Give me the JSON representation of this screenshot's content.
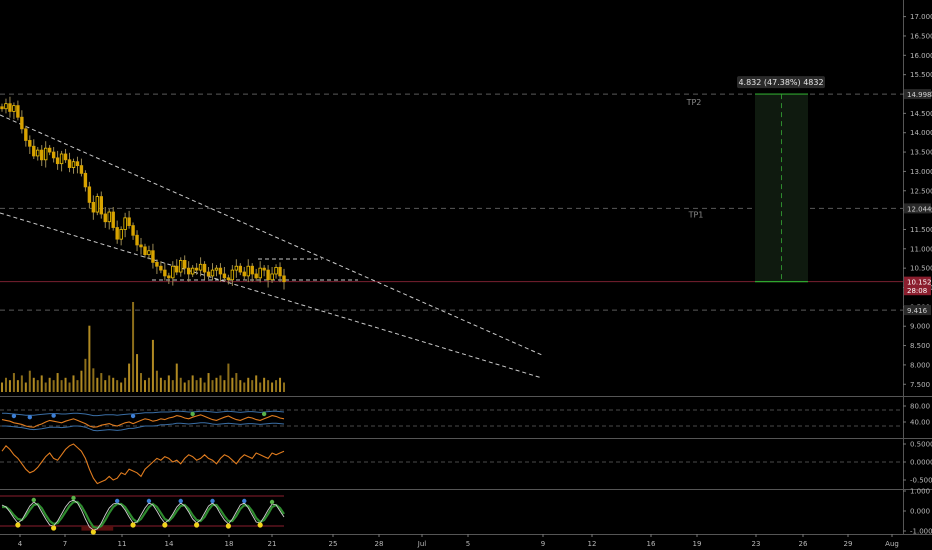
{
  "chart_data": {
    "type": "candlestick",
    "x_tick_labels": [
      "4",
      "7",
      "11",
      "14",
      "18",
      "21",
      "25",
      "28",
      "Jul",
      "5",
      "9",
      "12",
      "16",
      "19",
      "23",
      "26",
      "29",
      "Aug"
    ],
    "price_axis": {
      "ticks": [
        "17.000",
        "16.500",
        "16.000",
        "15.500",
        "15.000",
        "14.500",
        "14.000",
        "13.500",
        "13.000",
        "12.500",
        "12.000",
        "11.500",
        "11.000",
        "10.500",
        "10.000",
        "9.500",
        "9.000",
        "8.500",
        "8.000",
        "7.500"
      ],
      "range": [
        7.3,
        17.3
      ]
    },
    "price_markers": [
      {
        "label": "14.998",
        "value": 14.998,
        "style": "dark"
      },
      {
        "label": "12.044",
        "value": 12.044,
        "style": "dark"
      },
      {
        "label": "10.152",
        "value": 10.152,
        "style": "current"
      },
      {
        "label": "28:08",
        "value": 9.93,
        "style": "current"
      },
      {
        "label": "9.416",
        "value": 9.416,
        "style": "dark"
      }
    ],
    "take_profit_levels": [
      {
        "label": "TP2",
        "value": 14.998
      },
      {
        "label": "TP1",
        "value": 12.044
      }
    ],
    "projection_box": {
      "label": "4.832 (47.38%) 4832",
      "from": 10.152,
      "to": 14.998
    },
    "price_series": [
      14.62,
      14.75,
      14.55,
      14.7,
      14.4,
      14.1,
      13.8,
      13.65,
      13.4,
      13.55,
      13.3,
      13.6,
      13.5,
      13.35,
      13.2,
      13.45,
      13.3,
      13.1,
      13.25,
      13.15,
      12.95,
      12.6,
      12.2,
      11.95,
      12.35,
      11.9,
      11.7,
      11.95,
      11.55,
      11.25,
      11.5,
      11.8,
      11.6,
      11.35,
      11.1,
      11.05,
      10.85,
      10.95,
      10.65,
      10.55,
      10.45,
      10.3,
      10.25,
      10.55,
      10.4,
      10.7,
      10.5,
      10.35,
      10.5,
      10.45,
      10.6,
      10.4,
      10.3,
      10.45,
      10.5,
      10.35,
      10.25,
      10.2,
      10.45,
      10.55,
      10.4,
      10.3,
      10.55,
      10.35,
      10.25,
      10.5,
      10.45,
      10.2,
      10.35,
      10.52,
      10.3,
      10.15
    ],
    "volume_series": [
      4,
      6,
      5,
      8,
      5,
      7,
      4,
      9,
      6,
      5,
      7,
      4,
      6,
      5,
      8,
      5,
      6,
      4,
      7,
      5,
      9,
      14,
      28,
      10,
      6,
      8,
      5,
      7,
      6,
      5,
      4,
      6,
      12,
      38,
      16,
      8,
      5,
      6,
      22,
      9,
      6,
      5,
      7,
      5,
      12,
      6,
      4,
      5,
      7,
      5,
      6,
      4,
      8,
      5,
      6,
      7,
      5,
      12,
      6,
      8,
      5,
      4,
      6,
      5,
      7,
      4,
      6,
      5,
      4,
      5,
      6,
      4
    ],
    "indicator_1": {
      "ticks": [
        "80.00",
        "40.00"
      ],
      "levels": [
        70,
        30
      ],
      "series": [
        46,
        44,
        42,
        38,
        36,
        34,
        30,
        28,
        27,
        32,
        35,
        40,
        44,
        42,
        40,
        38,
        42,
        45,
        48,
        44,
        40,
        36,
        30,
        27,
        28,
        32,
        34,
        36,
        32,
        30,
        34,
        38,
        40,
        36,
        40,
        44,
        48,
        46,
        42,
        44,
        48,
        46,
        50,
        52,
        56,
        54,
        50,
        48,
        52,
        55,
        58,
        54,
        50,
        46,
        44,
        48,
        52,
        55,
        50,
        46,
        44,
        48,
        52,
        50,
        46,
        44,
        48,
        52,
        56,
        54,
        50,
        48
      ],
      "band_upper": [
        62,
        62,
        61,
        60,
        59,
        58,
        57,
        57,
        57,
        58,
        59,
        60,
        61,
        61,
        61,
        60,
        60,
        61,
        62,
        62,
        61,
        60,
        58,
        56,
        56,
        57,
        58,
        58,
        58,
        57,
        58,
        59,
        60,
        60,
        61,
        62,
        63,
        63,
        63,
        64,
        65,
        65,
        65,
        66,
        67,
        67,
        66,
        65,
        65,
        66,
        67,
        67,
        66,
        65,
        64,
        65,
        66,
        67,
        66,
        65,
        64,
        65,
        66,
        66,
        65,
        64,
        65,
        66,
        67,
        67,
        66,
        65
      ],
      "band_lower": [
        30,
        30,
        29,
        28,
        27,
        26,
        24,
        22,
        21,
        22,
        23,
        25,
        27,
        27,
        27,
        26,
        27,
        28,
        30,
        30,
        29,
        27,
        23,
        19,
        18,
        19,
        20,
        21,
        20,
        19,
        20,
        22,
        24,
        24,
        26,
        28,
        30,
        30,
        30,
        31,
        33,
        33,
        34,
        35,
        37,
        37,
        36,
        35,
        36,
        37,
        38,
        38,
        37,
        35,
        34,
        35,
        36,
        37,
        36,
        35,
        34,
        35,
        36,
        36,
        35,
        34,
        35,
        36,
        37,
        37,
        36,
        35
      ]
    },
    "indicator_2": {
      "ticks": [
        "0.5000",
        "0.0000",
        "-0.5000"
      ],
      "series": [
        0.3,
        0.45,
        0.35,
        0.2,
        0.1,
        -0.05,
        -0.2,
        -0.3,
        -0.25,
        -0.15,
        0.0,
        0.15,
        0.25,
        0.1,
        0.05,
        0.2,
        0.35,
        0.45,
        0.5,
        0.4,
        0.3,
        0.1,
        -0.2,
        -0.45,
        -0.6,
        -0.55,
        -0.5,
        -0.4,
        -0.5,
        -0.45,
        -0.3,
        -0.35,
        -0.2,
        -0.25,
        -0.3,
        -0.4,
        -0.2,
        -0.1,
        0.0,
        0.1,
        0.05,
        0.15,
        0.1,
        0.0,
        0.05,
        -0.05,
        0.1,
        0.2,
        0.15,
        0.05,
        0.1,
        0.2,
        0.1,
        0.05,
        -0.05,
        0.1,
        0.2,
        0.15,
        0.05,
        -0.05,
        0.1,
        0.2,
        0.15,
        0.1,
        0.25,
        0.2,
        0.15,
        0.1,
        0.25,
        0.2,
        0.25,
        0.3
      ]
    },
    "indicator_3": {
      "ticks": [
        "1.000",
        "0.000",
        "-1.000"
      ],
      "series": [
        0.3,
        0.2,
        -0.05,
        -0.35,
        -0.6,
        -0.45,
        -0.1,
        0.25,
        0.45,
        0.3,
        -0.05,
        -0.4,
        -0.7,
        -0.75,
        -0.5,
        -0.15,
        0.2,
        0.45,
        0.55,
        0.4,
        0.05,
        -0.4,
        -0.8,
        -0.95,
        -0.9,
        -0.6,
        -0.2,
        0.15,
        0.35,
        0.4,
        0.3,
        0.05,
        -0.3,
        -0.6,
        -0.55,
        -0.2,
        0.15,
        0.4,
        0.3,
        0.0,
        -0.35,
        -0.6,
        -0.45,
        -0.15,
        0.2,
        0.4,
        0.25,
        -0.05,
        -0.4,
        -0.6,
        -0.45,
        -0.1,
        0.25,
        0.4,
        0.2,
        -0.15,
        -0.45,
        -0.65,
        -0.4,
        -0.05,
        0.3,
        0.4,
        0.15,
        -0.2,
        -0.55,
        -0.6,
        -0.3,
        0.05,
        0.35,
        0.3,
        0.0,
        -0.3
      ],
      "signal": [
        0.2,
        0.2,
        0.05,
        -0.2,
        -0.4,
        -0.45,
        -0.25,
        0.05,
        0.3,
        0.35,
        0.15,
        -0.2,
        -0.5,
        -0.65,
        -0.6,
        -0.35,
        -0.05,
        0.25,
        0.45,
        0.45,
        0.25,
        -0.1,
        -0.5,
        -0.8,
        -0.85,
        -0.75,
        -0.45,
        -0.1,
        0.2,
        0.35,
        0.35,
        0.2,
        -0.1,
        -0.4,
        -0.55,
        -0.4,
        -0.1,
        0.2,
        0.35,
        0.2,
        -0.1,
        -0.4,
        -0.5,
        -0.3,
        0.0,
        0.25,
        0.3,
        0.1,
        -0.2,
        -0.45,
        -0.5,
        -0.3,
        0.05,
        0.3,
        0.3,
        0.05,
        -0.25,
        -0.5,
        -0.5,
        -0.25,
        0.1,
        0.3,
        0.25,
        0.0,
        -0.35,
        -0.55,
        -0.45,
        -0.15,
        0.2,
        0.3,
        0.15,
        -0.15
      ]
    }
  }
}
